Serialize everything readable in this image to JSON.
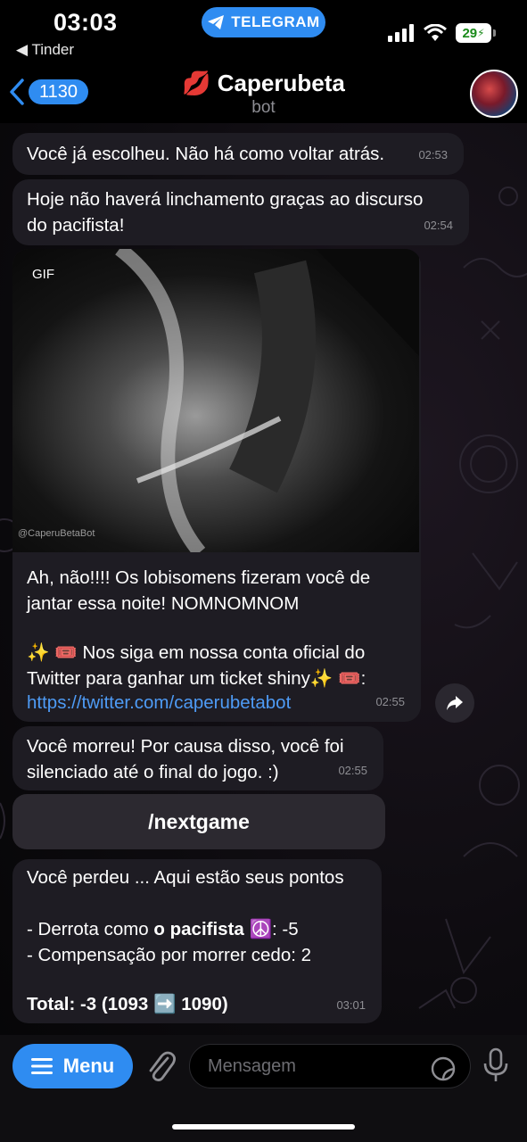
{
  "status_bar": {
    "time": "03:03",
    "back_app": "◀ Tinder",
    "telegram_pill": "TELEGRAM",
    "battery": "29"
  },
  "header": {
    "back_count": "1130",
    "title_emoji": "💋",
    "title": "Caperubeta",
    "subtitle": "bot"
  },
  "messages": [
    {
      "text": "Você já escolheu. Não há como voltar atrás.",
      "time": "02:53"
    },
    {
      "text": "Hoje não haverá linchamento graças ao discurso\ndo pacifista!",
      "time": "02:54"
    },
    {
      "gif_label": "GIF",
      "watermark": "@CaperuBetaBot",
      "caption_1": "Ah, não!!!! Os lobisomens fizeram você de\njantar essa noite! NOMNOMNOM",
      "caption_2": "✨ 🎟️ Nos siga em nossa conta oficial do\nTwitter para ganhar um ticket shiny✨ 🎟️:",
      "link": "https://twitter.com/caperubetabot",
      "time": "02:55"
    },
    {
      "text": "Você morreu! Por causa disso, você foi\nsilenciado até o final do jogo. :)",
      "time": "02:55"
    },
    {
      "line_1": "Você perdeu ... Aqui estão seus pontos",
      "line_2_prefix": "- Derrota como ",
      "line_2_bold": "o pacifista ☮️",
      "line_2_suffix": ": -5",
      "line_3": "- Compensação por morrer cedo: 2",
      "total": "Total: -3 (1093 ➡️ 1090)",
      "time": "03:01"
    }
  ],
  "command_button": "/nextgame",
  "input_bar": {
    "menu_label": "Menu",
    "placeholder": "Mensagem"
  },
  "colors": {
    "accent": "#2f8cf1",
    "bubble": "#1e1c23",
    "link": "#4e9bf5"
  }
}
